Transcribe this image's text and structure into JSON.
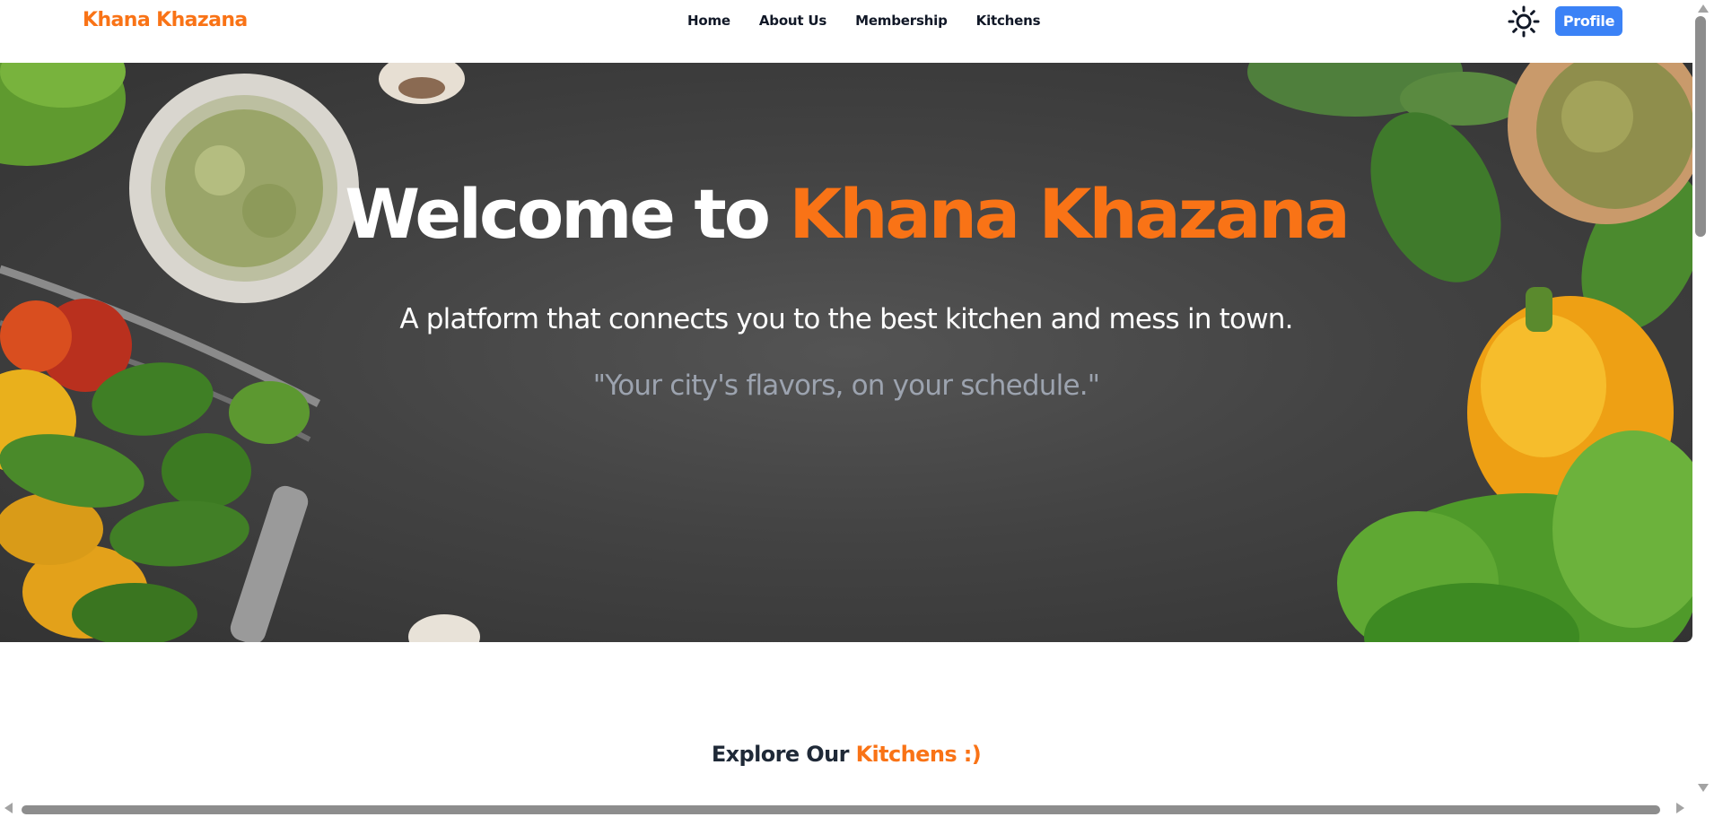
{
  "navbar": {
    "brand": "Khana Khazana",
    "links": [
      "Home",
      "About Us",
      "Membership",
      "Kitchens"
    ],
    "theme_toggle_icon": "sun-icon",
    "profile_label": "Profile"
  },
  "hero": {
    "title_prefix": "Welcome to ",
    "title_accent": "Khana Khazana",
    "subtitle": "A platform that connects you to the best kitchen and mess in town.",
    "tagline": "\"Your city's flavors, on your schedule.\""
  },
  "explore": {
    "heading_prefix": "Explore Our ",
    "heading_accent": "Kitchens :)"
  },
  "colors": {
    "accent": "#f97316",
    "profile_button": "#3b82f6",
    "hero_background": "#444444",
    "tagline_gray": "#9ca3af"
  }
}
